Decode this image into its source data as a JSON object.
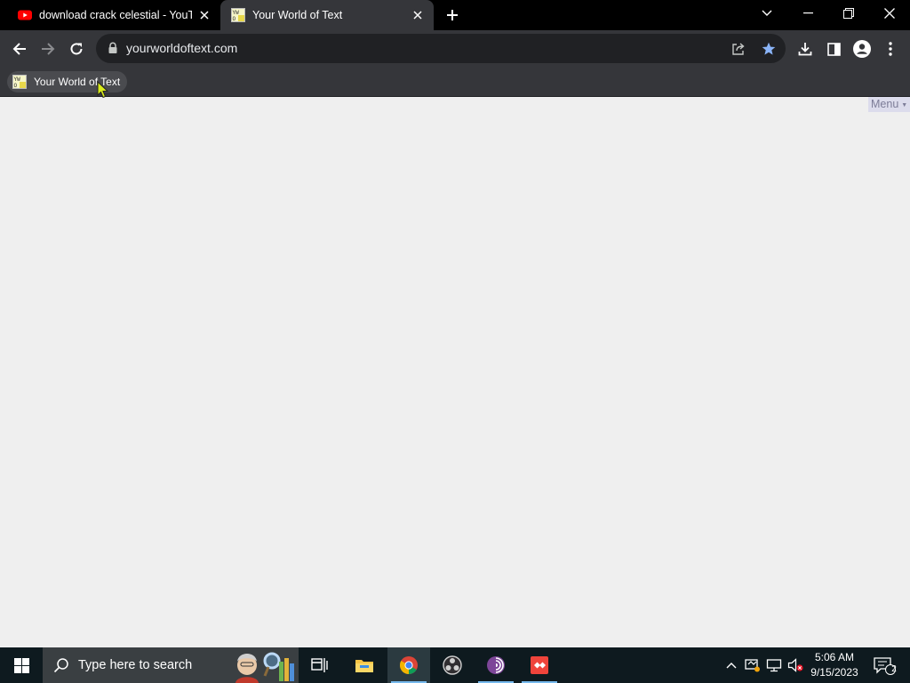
{
  "tabs": [
    {
      "title": "download crack celestial - YouTube",
      "active": false,
      "favicon": "youtube-icon"
    },
    {
      "title": "Your World of Text",
      "active": true,
      "favicon": "ywot-icon"
    }
  ],
  "omnibox": {
    "url": "yourworldoftext.com"
  },
  "bookmarks": [
    {
      "label": "Your World of Text"
    }
  ],
  "page": {
    "menu_label": "Menu",
    "menu_arrow": "▼"
  },
  "taskbar": {
    "search_placeholder": "Type here to search",
    "apps": [
      "task-view",
      "file-explorer",
      "chrome",
      "obs-studio",
      "tor-browser",
      "anydesk"
    ],
    "time": "5:06 AM",
    "date": "9/15/2023",
    "notification_count": "2"
  },
  "colors": {
    "accent_star": "#8ab4f8",
    "page_bg": "#efefef",
    "menu_bg": "#dcdcec",
    "youtube_red": "#ff0000"
  }
}
